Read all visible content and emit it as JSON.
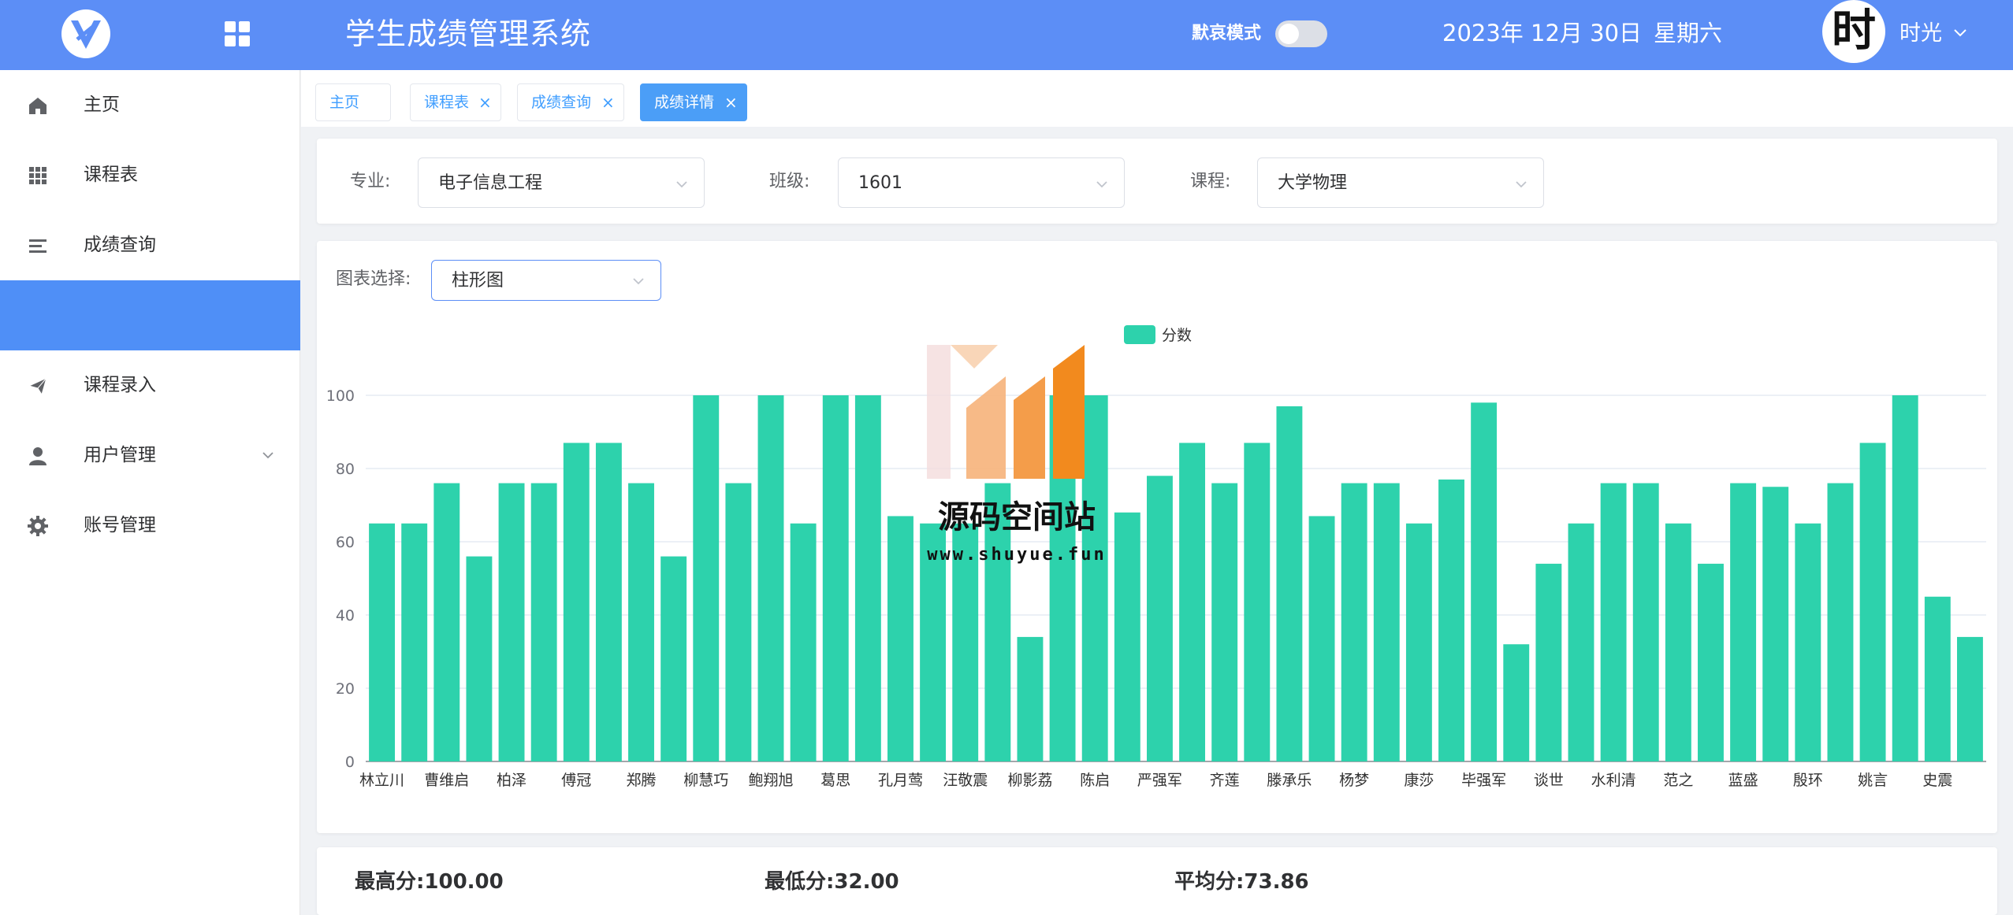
{
  "header": {
    "title": "学生成绩管理系统",
    "mourn_mode_label": "默哀模式",
    "mourn_mode_on": false,
    "date": "2023年 12月 30日",
    "weekday": "星期六",
    "avatar_char": "时",
    "user_name": "时光"
  },
  "sidebar": {
    "items": [
      {
        "label": "主页",
        "icon": "home-icon"
      },
      {
        "label": "课程表",
        "icon": "grid-icon"
      },
      {
        "label": "成绩查询",
        "icon": "list-icon"
      },
      {
        "label": "",
        "icon": "",
        "active": true
      },
      {
        "label": "课程录入",
        "icon": "send-icon"
      },
      {
        "label": "用户管理",
        "icon": "user-icon"
      },
      {
        "label": "账号管理",
        "icon": "gear-icon"
      }
    ]
  },
  "tabs": [
    {
      "label": "主页",
      "closable": false
    },
    {
      "label": "课程表",
      "closable": true
    },
    {
      "label": "成绩查询",
      "closable": true
    },
    {
      "label": "成绩详情",
      "closable": true,
      "active": true
    }
  ],
  "filters": {
    "major_label": "专业:",
    "major_value": "电子信息工程",
    "class_label": "班级:",
    "class_value": "1601",
    "course_label": "课程:",
    "course_value": "大学物理"
  },
  "chart_select": {
    "label": "图表选择:",
    "value": "柱形图"
  },
  "watermark": {
    "text": "源码空间站",
    "url": "www.shuyue.fun"
  },
  "stats": {
    "max_label": "最高分:",
    "max_value": "100.00",
    "min_label": "最低分:",
    "min_value": "32.00",
    "avg_label": "平均分:",
    "avg_value": "73.86"
  },
  "colors": {
    "header_bg": "#5c8ef6",
    "bar": "#2dd2ac",
    "active_tab": "#4b9ef7"
  },
  "chart_data": {
    "type": "bar",
    "legend": [
      "分数"
    ],
    "legend_position": "top-center",
    "ylim": [
      0,
      100
    ],
    "yticks": [
      0,
      20,
      40,
      60,
      80,
      100
    ],
    "grid": true,
    "x_labels_shown": [
      "林立川",
      "曹维启",
      "柏泽",
      "傅冠",
      "郑腾",
      "柳慧巧",
      "鲍翔旭",
      "葛思",
      "孔月莺",
      "汪敬震",
      "柳影荔",
      "陈启",
      "严强军",
      "齐莲",
      "滕承乐",
      "杨梦",
      "康莎",
      "毕强军",
      "谈世",
      "水利清",
      "范之",
      "蓝盛",
      "殷环",
      "姚言",
      "史震"
    ],
    "label_every": 2,
    "series": [
      {
        "name": "分数",
        "values": [
          65,
          65,
          76,
          56,
          76,
          76,
          87,
          87,
          76,
          56,
          100,
          76,
          100,
          65,
          100,
          100,
          67,
          65,
          65,
          76,
          34,
          100,
          100,
          68,
          78,
          87,
          76,
          87,
          97,
          67,
          76,
          76,
          65,
          77,
          98,
          32,
          54,
          65,
          76,
          76,
          65,
          54,
          76,
          75,
          65,
          76,
          87,
          100,
          45,
          34
        ]
      }
    ]
  }
}
